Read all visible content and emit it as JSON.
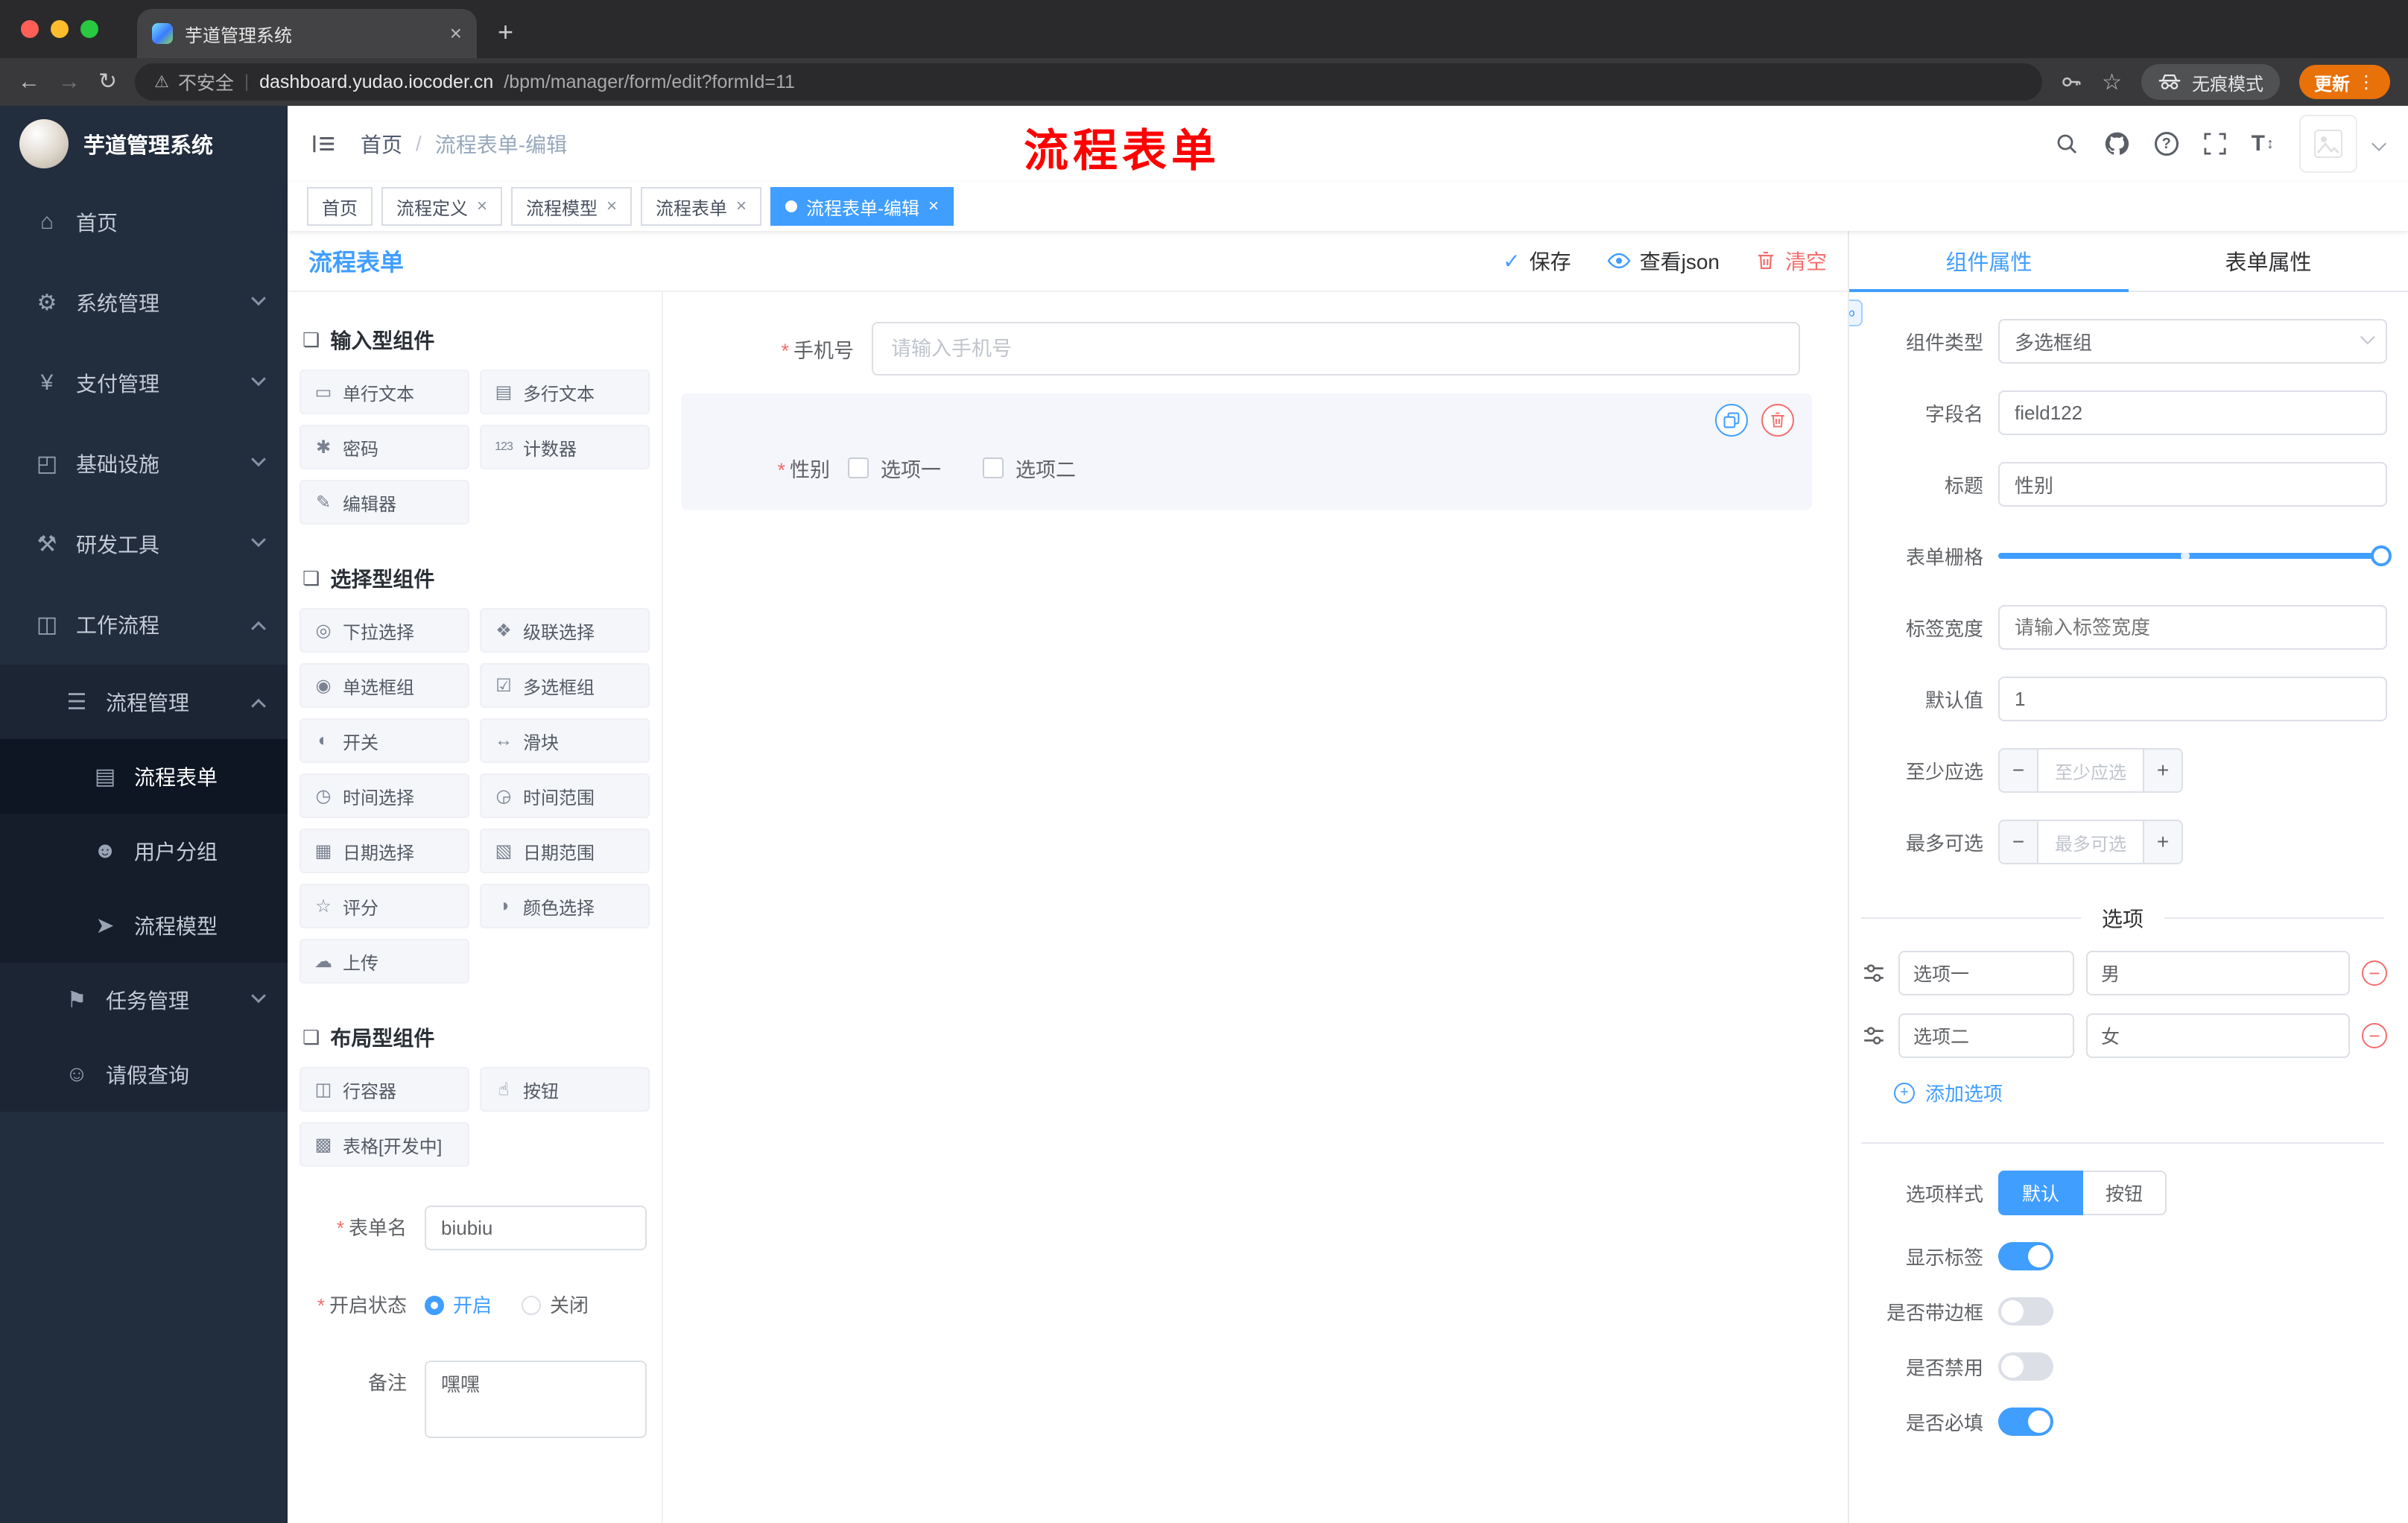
{
  "browser": {
    "tab_title": "芋道管理系统",
    "new_tab": "+",
    "security_label": "不安全",
    "url_host": "dashboard.yudao.iocoder.cn",
    "url_path": "/bpm/manager/form/edit?formId=11",
    "incognito_label": "无痕模式",
    "update_label": "更新"
  },
  "sidebar": {
    "logo_title": "芋道管理系统",
    "items": [
      {
        "key": "home",
        "label": "首页",
        "icon": "home-icon",
        "glyph": "⌂",
        "level": 1
      },
      {
        "key": "system-management",
        "label": "系统管理",
        "icon": "gear-icon",
        "glyph": "⚙",
        "level": 1,
        "chevron": "down"
      },
      {
        "key": "payment-management",
        "label": "支付管理",
        "icon": "yen-icon",
        "glyph": "¥",
        "level": 1,
        "chevron": "down"
      },
      {
        "key": "infrastructure",
        "label": "基础设施",
        "icon": "monitor-icon",
        "glyph": "◰",
        "level": 1,
        "chevron": "down"
      },
      {
        "key": "dev-tools",
        "label": "研发工具",
        "icon": "tools-icon",
        "glyph": "⚒",
        "level": 1,
        "chevron": "down"
      },
      {
        "key": "workflow",
        "label": "工作流程",
        "icon": "briefcase-icon",
        "glyph": "◫",
        "level": 1,
        "chevron": "up"
      },
      {
        "key": "process-management",
        "label": "流程管理",
        "icon": "list-icon",
        "glyph": "☰",
        "level": 2,
        "chevron": "up"
      },
      {
        "key": "process-form",
        "label": "流程表单",
        "icon": "document-icon",
        "glyph": "▤",
        "level": 3,
        "active": true
      },
      {
        "key": "user-group",
        "label": "用户分组",
        "icon": "user-group-icon",
        "glyph": "☻",
        "level": 3
      },
      {
        "key": "process-model",
        "label": "流程模型",
        "icon": "paper-plane-icon",
        "glyph": "➤",
        "level": 3
      },
      {
        "key": "task-management",
        "label": "任务管理",
        "icon": "flag-icon",
        "glyph": "⚑",
        "level": 2,
        "chevron": "down"
      },
      {
        "key": "leave-query",
        "label": "请假查询",
        "icon": "person-icon",
        "glyph": "☺",
        "level": 2
      }
    ]
  },
  "header": {
    "breadcrumb_home": "首页",
    "breadcrumb_separator": "/",
    "breadcrumb_current": "流程表单-编辑",
    "watermark": "流程表单"
  },
  "tags": [
    {
      "key": "home",
      "label": "首页",
      "closable": false,
      "active": false
    },
    {
      "key": "process-definition",
      "label": "流程定义",
      "closable": true,
      "active": false
    },
    {
      "key": "process-model",
      "label": "流程模型",
      "closable": true,
      "active": false
    },
    {
      "key": "process-form",
      "label": "流程表单",
      "closable": true,
      "active": false
    },
    {
      "key": "process-form-edit",
      "label": "流程表单-编辑",
      "closable": true,
      "active": true
    }
  ],
  "designer": {
    "title": "流程表单",
    "actions": {
      "save": "保存",
      "view_json": "查看json",
      "clear": "清空"
    },
    "sections": [
      {
        "title": "输入型组件",
        "items": [
          {
            "key": "text-input",
            "label": "单行文本",
            "icon": "text-input-icon",
            "glyph": "▭"
          },
          {
            "key": "textarea",
            "label": "多行文本",
            "icon": "textarea-icon",
            "glyph": "▤"
          },
          {
            "key": "password",
            "label": "密码",
            "icon": "lock-icon",
            "glyph": "✱"
          },
          {
            "key": "counter",
            "label": "计数器",
            "icon": "counter-icon",
            "glyph": "123"
          },
          {
            "key": "editor",
            "label": "编辑器",
            "icon": "editor-icon",
            "glyph": "✎"
          }
        ]
      },
      {
        "title": "选择型组件",
        "items": [
          {
            "key": "select",
            "label": "下拉选择",
            "icon": "select-icon",
            "glyph": "◎"
          },
          {
            "key": "cascader",
            "label": "级联选择",
            "icon": "cascader-icon",
            "glyph": "❖"
          },
          {
            "key": "radio-group",
            "label": "单选框组",
            "icon": "radio-icon",
            "glyph": "◉"
          },
          {
            "key": "checkbox-group",
            "label": "多选框组",
            "icon": "checkbox-icon",
            "glyph": "☑"
          },
          {
            "key": "switch",
            "label": "开关",
            "icon": "switch-icon",
            "glyph": "◐"
          },
          {
            "key": "slider",
            "label": "滑块",
            "icon": "slider-icon",
            "glyph": "↔"
          },
          {
            "key": "time-picker",
            "label": "时间选择",
            "icon": "clock-icon",
            "glyph": "◷"
          },
          {
            "key": "time-range",
            "label": "时间范围",
            "icon": "clock-range-icon",
            "glyph": "◶"
          },
          {
            "key": "date-picker",
            "label": "日期选择",
            "icon": "calendar-icon",
            "glyph": "▦"
          },
          {
            "key": "date-range",
            "label": "日期范围",
            "icon": "calendar-range-icon",
            "glyph": "▧"
          },
          {
            "key": "rate",
            "label": "评分",
            "icon": "star-icon",
            "glyph": "☆"
          },
          {
            "key": "color-picker",
            "label": "颜色选择",
            "icon": "color-icon",
            "glyph": "◑"
          },
          {
            "key": "upload",
            "label": "上传",
            "icon": "upload-icon",
            "glyph": "☁"
          }
        ]
      },
      {
        "title": "布局型组件",
        "items": [
          {
            "key": "row-container",
            "label": "行容器",
            "icon": "container-icon",
            "glyph": "◫"
          },
          {
            "key": "button",
            "label": "按钮",
            "icon": "pointer-icon",
            "glyph": "☝"
          },
          {
            "key": "table",
            "label": "表格[开发中]",
            "icon": "table-icon",
            "glyph": "▩"
          }
        ]
      }
    ],
    "meta_form": {
      "name_label": "表单名",
      "name_value": "biubiu",
      "status_label": "开启状态",
      "status_on": "开启",
      "status_off": "关闭",
      "status_selected": "开启",
      "remark_label": "备注",
      "remark_value": "嘿嘿"
    },
    "canvas": {
      "phone_label": "手机号",
      "phone_placeholder": "请输入手机号",
      "gender_label": "性别",
      "gender_options": [
        "选项一",
        "选项二"
      ]
    }
  },
  "props": {
    "tab_component": "组件属性",
    "tab_form": "表单属性",
    "component_type_label": "组件类型",
    "component_type_value": "多选框组",
    "field_name_label": "字段名",
    "field_name_value": "field122",
    "title_label": "标题",
    "title_value": "性别",
    "grid_label": "表单栅格",
    "label_width_label": "标签宽度",
    "label_width_placeholder": "请输入标签宽度",
    "default_label": "默认值",
    "default_value": "1",
    "min_label": "至少应选",
    "min_placeholder": "至少应选",
    "max_label": "最多可选",
    "max_placeholder": "最多可选",
    "options_divider": "选项",
    "options": [
      {
        "name": "选项一",
        "value": "男"
      },
      {
        "name": "选项二",
        "value": "女"
      }
    ],
    "add_option": "添加选项",
    "style_label": "选项样式",
    "style_default": "默认",
    "style_button": "按钮",
    "style_selected": "默认",
    "switches": [
      {
        "key": "show-label",
        "label": "显示标签",
        "on": true
      },
      {
        "key": "bordered",
        "label": "是否带边框",
        "on": false
      },
      {
        "key": "disabled",
        "label": "是否禁用",
        "on": false
      },
      {
        "key": "required",
        "label": "是否必填",
        "on": true
      }
    ]
  },
  "colors": {
    "accent": "#409eff",
    "danger": "#f56c6c",
    "watermark": "#ff0000",
    "update_button": "#e8710a"
  }
}
